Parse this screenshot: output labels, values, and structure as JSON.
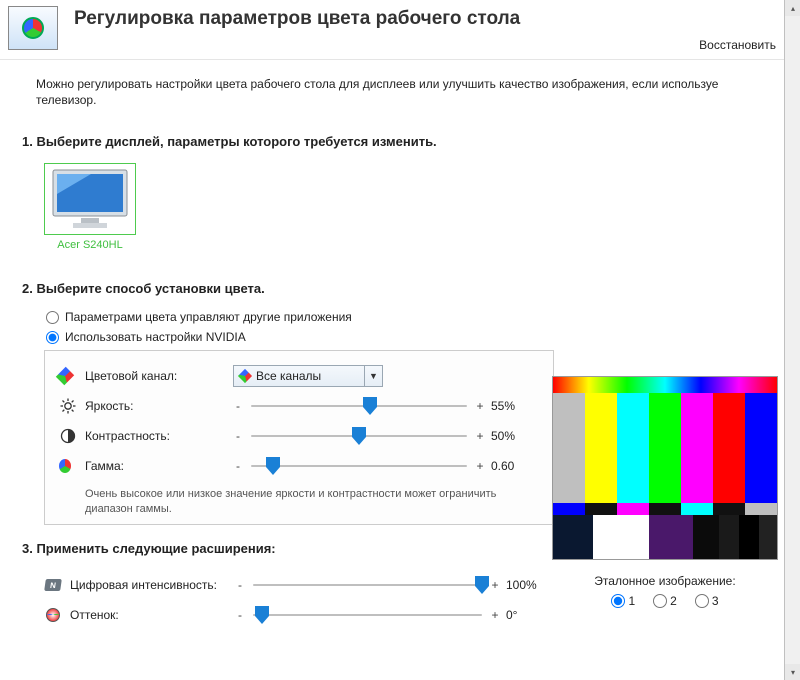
{
  "header": {
    "title": "Регулировка параметров цвета рабочего стола",
    "restore": "Восстановить"
  },
  "intro": "Можно регулировать настройки цвета рабочего стола для дисплеев или улучшить качество изображения, если используе телевизор.",
  "section1": {
    "heading": "1. Выберите дисплей, параметры которого требуется изменить.",
    "display_name": "Acer S240HL"
  },
  "section2": {
    "heading": "2. Выберите способ установки цвета.",
    "radio_other": "Параметрами цвета управляют другие приложения",
    "radio_nvidia": "Использовать настройки NVIDIA",
    "channel_label": "Цветовой канал:",
    "channel_value": "Все каналы",
    "brightness": {
      "label": "Яркость:",
      "value": "55%",
      "pos": 55
    },
    "contrast": {
      "label": "Контрастность:",
      "value": "50%",
      "pos": 50
    },
    "gamma": {
      "label": "Гамма:",
      "value": "0.60",
      "pos": 10
    },
    "hint": "Очень высокое или низкое значение яркости и контрастности может ограничить диапазон гаммы."
  },
  "section3": {
    "heading": "3. Применить следующие расширения:",
    "vibrance": {
      "label": "Цифровая интенсивность:",
      "value": "100%",
      "pos": 100
    },
    "hue": {
      "label": "Оттенок:",
      "value": "0°",
      "pos": 4
    }
  },
  "reference": {
    "caption": "Эталонное изображение:",
    "opts": [
      "1",
      "2",
      "3"
    ],
    "selected": "1"
  },
  "glyphs": {
    "minus": "-",
    "plus": "+"
  }
}
